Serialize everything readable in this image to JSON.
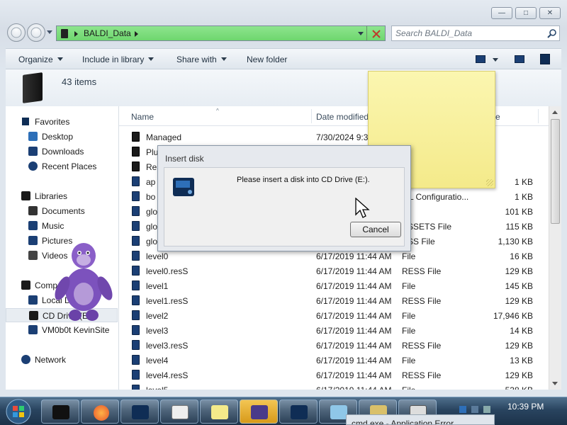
{
  "window": {
    "address": "BALDI_Data",
    "search_placeholder": "Search BALDI_Data",
    "controls": {
      "minimize": "—",
      "maximize": "□",
      "close": "✕"
    }
  },
  "toolbar": {
    "organize": "Organize",
    "include_in_library": "Include in library",
    "share_with": "Share with",
    "new_folder": "New folder"
  },
  "info": {
    "item_count": "43 items"
  },
  "nav": {
    "favorites": "Favorites",
    "desktop": "Desktop",
    "downloads": "Downloads",
    "recent_places": "Recent Places",
    "libraries": "Libraries",
    "documents": "Documents",
    "music": "Music",
    "pictures": "Pictures",
    "videos": "Videos",
    "computer": "Comp",
    "local_disk": "Local D",
    "cd_drive": "CD Drive (E:)",
    "vm_share": "VM0b0t KevinSite",
    "network": "Network"
  },
  "columns": {
    "name": "Name",
    "date_modified": "Date modified",
    "type": "e",
    "size": ""
  },
  "files": [
    {
      "name": "Managed",
      "date": "7/30/2024 9:38",
      "type": "",
      "size": ""
    },
    {
      "name": "Plu",
      "date": "",
      "type": "",
      "size": ""
    },
    {
      "name": "Res",
      "date": "",
      "type": "",
      "size": ""
    },
    {
      "name": "ap",
      "date": "",
      "type": "",
      "size": "1 KB"
    },
    {
      "name": "bo",
      "date": "",
      "type": "ML Configuratio...",
      "size": "1 KB"
    },
    {
      "name": "glo",
      "date": "",
      "type": "ile",
      "size": "101 KB"
    },
    {
      "name": "glo",
      "date": "",
      "type": "ESSETS File",
      "size": "115 KB"
    },
    {
      "name": "glo",
      "date": "",
      "type": "ESS File",
      "size": "1,130 KB"
    },
    {
      "name": "level0",
      "date": "6/17/2019 11:44 AM",
      "type": "File",
      "size": "16 KB"
    },
    {
      "name": "level0.resS",
      "date": "6/17/2019 11:44 AM",
      "type": "RESS File",
      "size": "129 KB"
    },
    {
      "name": "level1",
      "date": "6/17/2019 11:44 AM",
      "type": "File",
      "size": "145 KB"
    },
    {
      "name": "level1.resS",
      "date": "6/17/2019 11:44 AM",
      "type": "RESS File",
      "size": "129 KB"
    },
    {
      "name": "level2",
      "date": "6/17/2019 11:44 AM",
      "type": "File",
      "size": "17,946 KB"
    },
    {
      "name": "level3",
      "date": "6/17/2019 11:44 AM",
      "type": "File",
      "size": "14 KB"
    },
    {
      "name": "level3.resS",
      "date": "6/17/2019 11:44 AM",
      "type": "RESS File",
      "size": "129 KB"
    },
    {
      "name": "level4",
      "date": "6/17/2019 11:44 AM",
      "type": "File",
      "size": "13 KB"
    },
    {
      "name": "level4.resS",
      "date": "6/17/2019 11:44 AM",
      "type": "RESS File",
      "size": "129 KB"
    },
    {
      "name": "level5",
      "date": "6/17/2019 11:44 AM",
      "type": "File",
      "size": "538 KB"
    }
  ],
  "dialog": {
    "title": "Insert disk",
    "message": "Please insert a disk into CD Drive (E:).",
    "cancel": "Cancel"
  },
  "taskbar": {
    "clock": "10:39 PM",
    "app_error": "cmd.exe - Application Error"
  },
  "colors": {
    "address_bar": "#7ddc7d",
    "sticky_note": "#f8ef9c",
    "taskbar": "#2a4560",
    "file_icon": "#1b3f74",
    "bonzi": "#8a5fc8"
  },
  "icons": [
    "back-icon",
    "forward-icon",
    "folder-icon",
    "close-x-icon",
    "search-icon",
    "disk-icon",
    "star-icon",
    "start-orb-icon",
    "firefox-icon"
  ]
}
